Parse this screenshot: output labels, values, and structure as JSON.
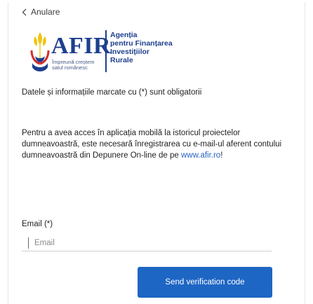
{
  "nav": {
    "back_label": "Anulare"
  },
  "logo": {
    "brand": "AFIR",
    "tagline": "Împreună creștem satul românesc",
    "full_name_lines": [
      "Agenția",
      "pentru Finanțarea",
      "Investițiilor",
      "Rurale"
    ],
    "colors": {
      "blue": "#1d3f8e",
      "yellow": "#f1c40f",
      "red": "#d62d2d"
    }
  },
  "form": {
    "required_note": "Datele și informațiile marcate cu (*) sunt obligatorii",
    "intro_text": "Pentru a avea acces în aplicația mobilă la istoricul proiectelor dumneavoastră, este necesară înregistrarea cu e-mail-ul aferent contului dumneavoastră din Depunere On-line de pe",
    "intro_link": "www.afir.ro",
    "intro_suffix": "!",
    "email_label": "Email (*)",
    "email_placeholder": "Email",
    "email_value": "",
    "send_label": "Send verification code"
  },
  "theme": {
    "accent": "#1e66c4",
    "link": "#2563c4"
  }
}
